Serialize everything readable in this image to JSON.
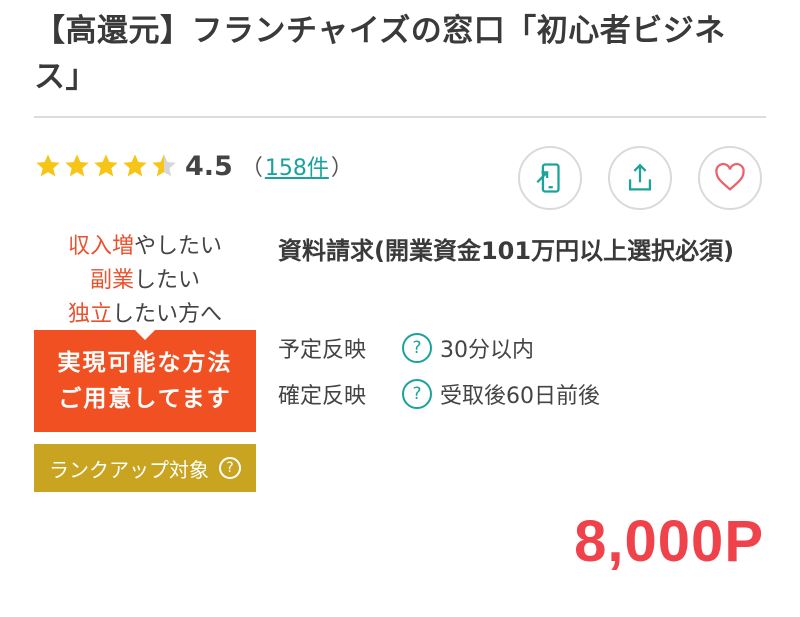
{
  "title": "【高還元】フランチャイズの窓口「初心者ビジネス」",
  "rating": {
    "stars_filled": 4.5,
    "stars_total": 5,
    "value": "4.5",
    "paren_open": "（",
    "count": "158件",
    "paren_close": "）"
  },
  "actions": {
    "mobile_icon": "smartphone-arrow-icon",
    "share_icon": "share-icon",
    "favorite_icon": "heart-icon"
  },
  "banner": {
    "line1_highlight": "収入増",
    "line1_rest": "やしたい",
    "line2_highlight": "副業",
    "line2_rest": "したい",
    "line3_highlight": "独立",
    "line3_rest": "したい方へ",
    "red_line1": "実現可能な方法",
    "red_line2": "ご用意してます"
  },
  "rank_up": {
    "label": "ランクアップ対象",
    "help": "?"
  },
  "condition": "資料請求(開業資金101万円以上選択必須)",
  "info": [
    {
      "label": "予定反映",
      "help": "?",
      "value": "30分以内"
    },
    {
      "label": "確定反映",
      "help": "?",
      "value": "受取後60日前後"
    }
  ],
  "points": "8,000P",
  "colors": {
    "accent_teal": "#1aa39a",
    "points_red": "#f0424a",
    "banner_orange": "#f15122",
    "rank_gold": "#c9a420",
    "star_yellow": "#f5c518"
  }
}
